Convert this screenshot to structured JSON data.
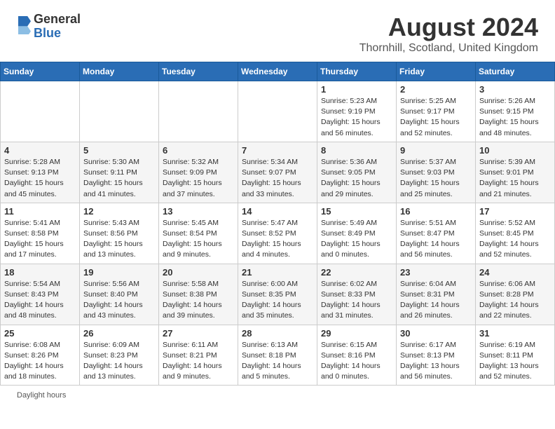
{
  "header": {
    "logo_line1": "General",
    "logo_line2": "Blue",
    "main_title": "August 2024",
    "subtitle": "Thornhill, Scotland, United Kingdom"
  },
  "calendar": {
    "days_of_week": [
      "Sunday",
      "Monday",
      "Tuesday",
      "Wednesday",
      "Thursday",
      "Friday",
      "Saturday"
    ],
    "weeks": [
      [
        {
          "day": "",
          "info": ""
        },
        {
          "day": "",
          "info": ""
        },
        {
          "day": "",
          "info": ""
        },
        {
          "day": "",
          "info": ""
        },
        {
          "day": "1",
          "info": "Sunrise: 5:23 AM\nSunset: 9:19 PM\nDaylight: 15 hours\nand 56 minutes."
        },
        {
          "day": "2",
          "info": "Sunrise: 5:25 AM\nSunset: 9:17 PM\nDaylight: 15 hours\nand 52 minutes."
        },
        {
          "day": "3",
          "info": "Sunrise: 5:26 AM\nSunset: 9:15 PM\nDaylight: 15 hours\nand 48 minutes."
        }
      ],
      [
        {
          "day": "4",
          "info": "Sunrise: 5:28 AM\nSunset: 9:13 PM\nDaylight: 15 hours\nand 45 minutes."
        },
        {
          "day": "5",
          "info": "Sunrise: 5:30 AM\nSunset: 9:11 PM\nDaylight: 15 hours\nand 41 minutes."
        },
        {
          "day": "6",
          "info": "Sunrise: 5:32 AM\nSunset: 9:09 PM\nDaylight: 15 hours\nand 37 minutes."
        },
        {
          "day": "7",
          "info": "Sunrise: 5:34 AM\nSunset: 9:07 PM\nDaylight: 15 hours\nand 33 minutes."
        },
        {
          "day": "8",
          "info": "Sunrise: 5:36 AM\nSunset: 9:05 PM\nDaylight: 15 hours\nand 29 minutes."
        },
        {
          "day": "9",
          "info": "Sunrise: 5:37 AM\nSunset: 9:03 PM\nDaylight: 15 hours\nand 25 minutes."
        },
        {
          "day": "10",
          "info": "Sunrise: 5:39 AM\nSunset: 9:01 PM\nDaylight: 15 hours\nand 21 minutes."
        }
      ],
      [
        {
          "day": "11",
          "info": "Sunrise: 5:41 AM\nSunset: 8:58 PM\nDaylight: 15 hours\nand 17 minutes."
        },
        {
          "day": "12",
          "info": "Sunrise: 5:43 AM\nSunset: 8:56 PM\nDaylight: 15 hours\nand 13 minutes."
        },
        {
          "day": "13",
          "info": "Sunrise: 5:45 AM\nSunset: 8:54 PM\nDaylight: 15 hours\nand 9 minutes."
        },
        {
          "day": "14",
          "info": "Sunrise: 5:47 AM\nSunset: 8:52 PM\nDaylight: 15 hours\nand 4 minutes."
        },
        {
          "day": "15",
          "info": "Sunrise: 5:49 AM\nSunset: 8:49 PM\nDaylight: 15 hours\nand 0 minutes."
        },
        {
          "day": "16",
          "info": "Sunrise: 5:51 AM\nSunset: 8:47 PM\nDaylight: 14 hours\nand 56 minutes."
        },
        {
          "day": "17",
          "info": "Sunrise: 5:52 AM\nSunset: 8:45 PM\nDaylight: 14 hours\nand 52 minutes."
        }
      ],
      [
        {
          "day": "18",
          "info": "Sunrise: 5:54 AM\nSunset: 8:43 PM\nDaylight: 14 hours\nand 48 minutes."
        },
        {
          "day": "19",
          "info": "Sunrise: 5:56 AM\nSunset: 8:40 PM\nDaylight: 14 hours\nand 43 minutes."
        },
        {
          "day": "20",
          "info": "Sunrise: 5:58 AM\nSunset: 8:38 PM\nDaylight: 14 hours\nand 39 minutes."
        },
        {
          "day": "21",
          "info": "Sunrise: 6:00 AM\nSunset: 8:35 PM\nDaylight: 14 hours\nand 35 minutes."
        },
        {
          "day": "22",
          "info": "Sunrise: 6:02 AM\nSunset: 8:33 PM\nDaylight: 14 hours\nand 31 minutes."
        },
        {
          "day": "23",
          "info": "Sunrise: 6:04 AM\nSunset: 8:31 PM\nDaylight: 14 hours\nand 26 minutes."
        },
        {
          "day": "24",
          "info": "Sunrise: 6:06 AM\nSunset: 8:28 PM\nDaylight: 14 hours\nand 22 minutes."
        }
      ],
      [
        {
          "day": "25",
          "info": "Sunrise: 6:08 AM\nSunset: 8:26 PM\nDaylight: 14 hours\nand 18 minutes."
        },
        {
          "day": "26",
          "info": "Sunrise: 6:09 AM\nSunset: 8:23 PM\nDaylight: 14 hours\nand 13 minutes."
        },
        {
          "day": "27",
          "info": "Sunrise: 6:11 AM\nSunset: 8:21 PM\nDaylight: 14 hours\nand 9 minutes."
        },
        {
          "day": "28",
          "info": "Sunrise: 6:13 AM\nSunset: 8:18 PM\nDaylight: 14 hours\nand 5 minutes."
        },
        {
          "day": "29",
          "info": "Sunrise: 6:15 AM\nSunset: 8:16 PM\nDaylight: 14 hours\nand 0 minutes."
        },
        {
          "day": "30",
          "info": "Sunrise: 6:17 AM\nSunset: 8:13 PM\nDaylight: 13 hours\nand 56 minutes."
        },
        {
          "day": "31",
          "info": "Sunrise: 6:19 AM\nSunset: 8:11 PM\nDaylight: 13 hours\nand 52 minutes."
        }
      ]
    ]
  },
  "footer": {
    "text": "Daylight hours"
  }
}
